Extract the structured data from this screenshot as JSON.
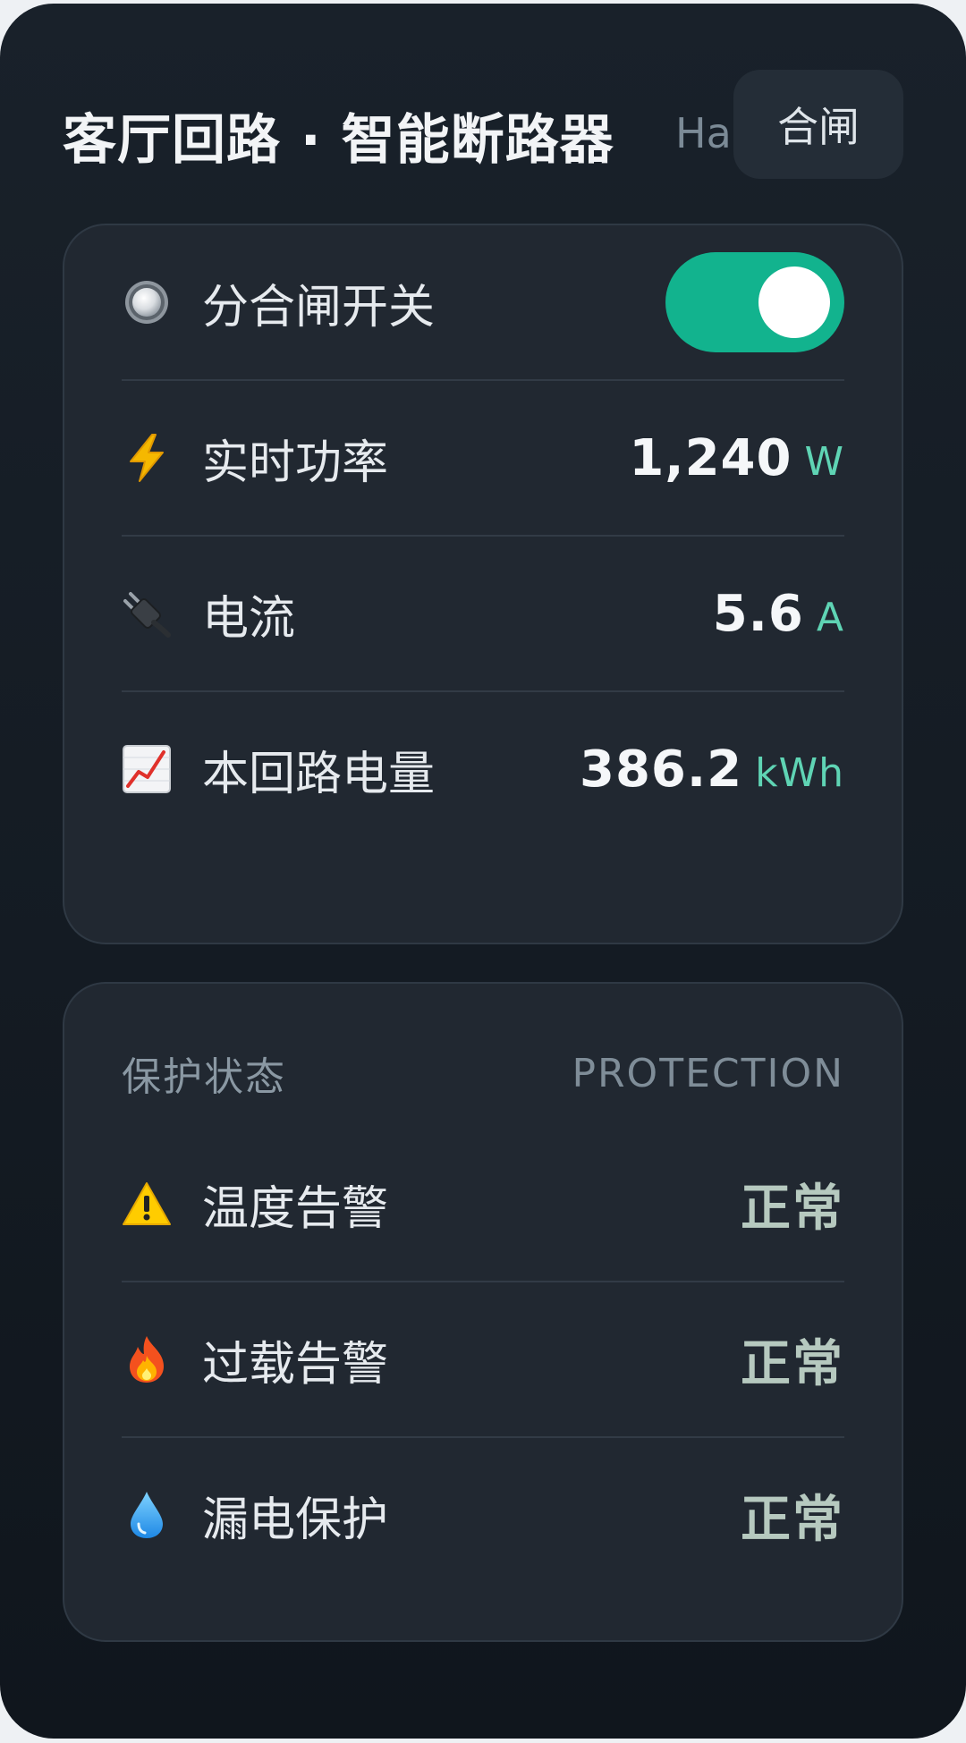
{
  "header": {
    "title": "客厅回路 · 智能断路器",
    "subtitle": "Ha",
    "state_label": "合闸"
  },
  "main": {
    "switch": {
      "label": "分合闸开关",
      "icon": "radio-button-icon",
      "on": true,
      "on_color": "#12b38e"
    },
    "power": {
      "label": "实时功率",
      "icon": "lightning-icon",
      "value": "1,240",
      "unit": "W"
    },
    "current": {
      "label": "电流",
      "icon": "plug-icon",
      "value": "5.6",
      "unit": "A"
    },
    "energy": {
      "label": "本回路电量",
      "icon": "chart-increasing-icon",
      "value": "386.2",
      "unit": "kWh"
    }
  },
  "protection": {
    "title": "保护状态",
    "title_en": "PROTECTION",
    "items": [
      {
        "label": "温度告警",
        "icon": "warning-icon",
        "status": "正常"
      },
      {
        "label": "过载告警",
        "icon": "fire-icon",
        "status": "正常"
      },
      {
        "label": "漏电保护",
        "icon": "droplet-icon",
        "status": "正常"
      }
    ]
  },
  "colors": {
    "accent": "#12b38e",
    "unit": "#5fd4b4",
    "status_ok": "#b6c9bf",
    "background": "#161d25"
  }
}
